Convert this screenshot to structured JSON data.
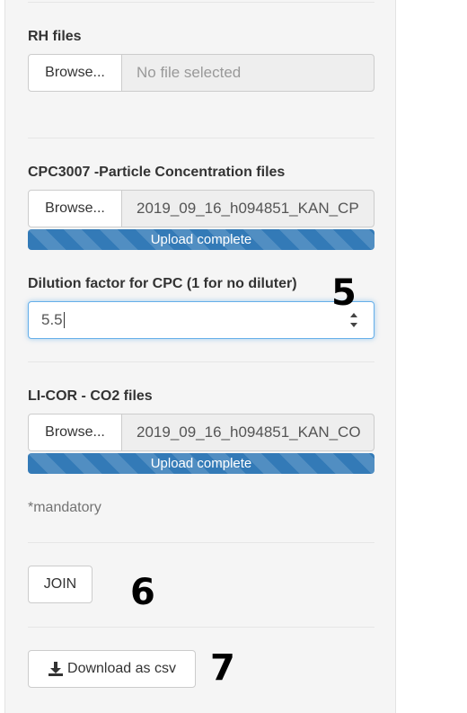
{
  "rh": {
    "label": "RH files",
    "browse_label": "Browse...",
    "file_text": "No file selected"
  },
  "cpc": {
    "label": "CPC3007 -Particle Concentration files",
    "browse_label": "Browse...",
    "file_text": "2019_09_16_h094851_KAN_CP",
    "progress_text": "Upload complete",
    "progress_fraction": 1.0
  },
  "dilution": {
    "label": "Dilution factor for CPC (1 for no diluter)",
    "value": "5.5"
  },
  "licor": {
    "label": "LI-COR - CO2 files",
    "browse_label": "Browse...",
    "file_text": "2019_09_16_h094851_KAN_CO",
    "progress_text": "Upload complete",
    "progress_fraction": 1.0
  },
  "mandatory_note": "*mandatory",
  "join_button": "JOIN",
  "download": {
    "label": "Download as csv",
    "icon": "download-icon"
  },
  "annotations": {
    "a5": "5",
    "a6": "6",
    "a7": "7"
  },
  "colors": {
    "progress": "#337ab7",
    "focus_border": "#66afe9",
    "panel": "#f5f5f5"
  }
}
